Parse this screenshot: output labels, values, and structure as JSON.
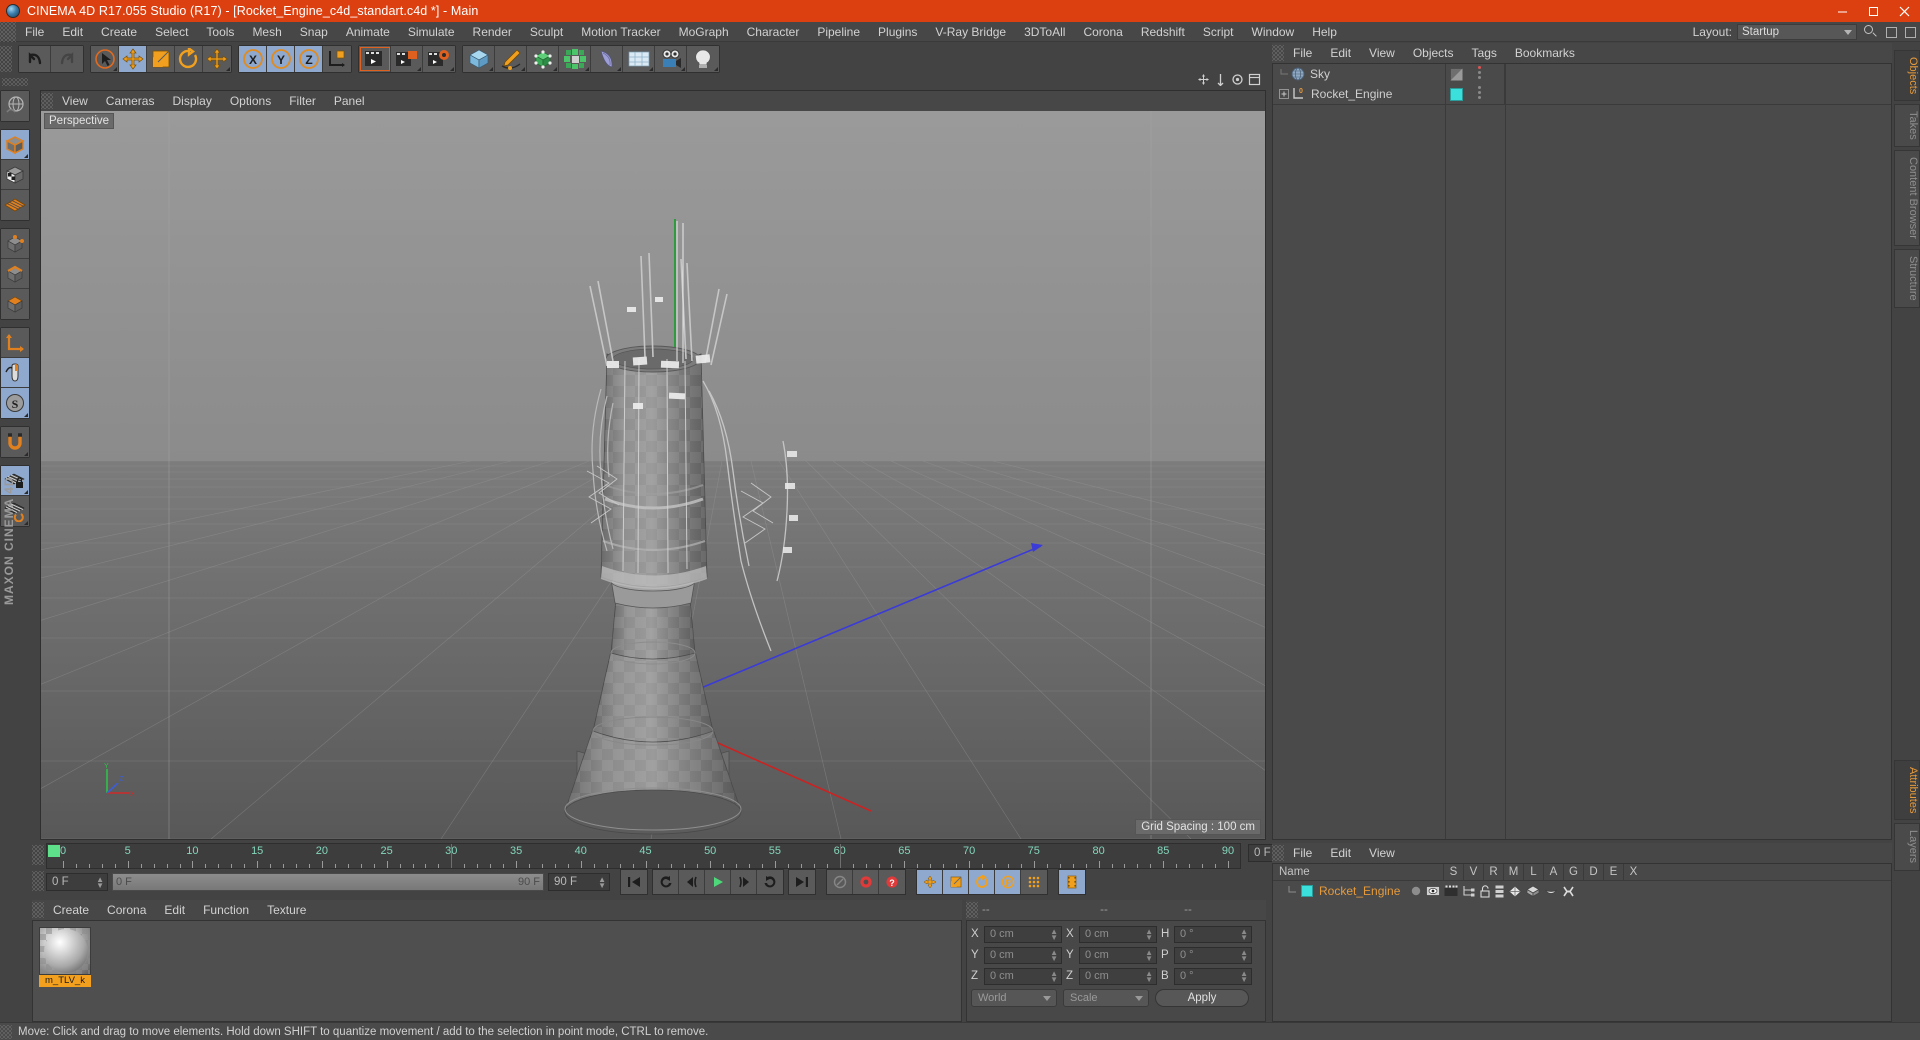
{
  "window": {
    "title": "CINEMA 4D R17.055 Studio (R17) - [Rocket_Engine_c4d_standart.c4d *] - Main",
    "minimize": "–",
    "maximize": "❐",
    "close": "✕"
  },
  "menubar": {
    "items": [
      "File",
      "Edit",
      "Create",
      "Select",
      "Tools",
      "Mesh",
      "Snap",
      "Animate",
      "Simulate",
      "Render",
      "Sculpt",
      "Motion Tracker",
      "MoGraph",
      "Character",
      "Pipeline",
      "Plugins",
      "V-Ray Bridge",
      "3DToAll",
      "Corona",
      "Redshift",
      "Script",
      "Window",
      "Help"
    ],
    "layout_label": "Layout:",
    "layout_value": "Startup",
    "search_icon": "search-icon"
  },
  "toolbar": {
    "groups": [
      {
        "name": "undo-redo",
        "buttons": [
          {
            "icon": "undo-icon",
            "label": "Undo",
            "active": false
          },
          {
            "icon": "redo-icon",
            "label": "Redo",
            "active": false,
            "disabled": true
          }
        ]
      },
      {
        "name": "transform-tools",
        "buttons": [
          {
            "icon": "select-live-icon",
            "label": "Live Selection",
            "active": false,
            "corner": true
          },
          {
            "icon": "move-icon",
            "label": "Move",
            "active": true
          },
          {
            "icon": "scale-icon",
            "label": "Scale",
            "active": false
          },
          {
            "icon": "rotate-icon",
            "label": "Rotate",
            "active": false
          },
          {
            "icon": "move-alt-icon",
            "label": "Move (Alt)",
            "active": false,
            "corner": true
          }
        ]
      },
      {
        "name": "axis-locks",
        "buttons": [
          {
            "icon": "axis-x-icon",
            "label": "X",
            "active": true
          },
          {
            "icon": "axis-y-icon",
            "label": "Y",
            "active": true
          },
          {
            "icon": "axis-z-icon",
            "label": "Z",
            "active": true
          },
          {
            "icon": "world-coord-icon",
            "label": "World / Object",
            "active": false
          }
        ]
      },
      {
        "name": "render-tools",
        "buttons": [
          {
            "icon": "render-view-icon",
            "label": "Render View",
            "active": false,
            "selected": true
          },
          {
            "icon": "render-picture-viewer-icon",
            "label": "Render to Picture Viewer",
            "active": false,
            "corner": true
          },
          {
            "icon": "render-settings-icon",
            "label": "Edit Render Settings",
            "active": false,
            "corner": true
          }
        ]
      },
      {
        "name": "create-objects",
        "buttons": [
          {
            "icon": "cube-primitive-icon",
            "label": "Cube",
            "active": false,
            "corner": true
          },
          {
            "icon": "spline-pen-icon",
            "label": "Pen / Spline",
            "active": false,
            "corner": true
          },
          {
            "icon": "nurbs-icon",
            "label": "Subdivision Surface",
            "active": false,
            "corner": true
          },
          {
            "icon": "array-icon",
            "label": "Array / Generators",
            "active": false,
            "corner": true
          },
          {
            "icon": "deformer-icon",
            "label": "Bend Deformer",
            "active": false,
            "corner": true
          },
          {
            "icon": "environment-icon",
            "label": "Floor / Environment",
            "active": false,
            "corner": true
          },
          {
            "icon": "camera-icon",
            "label": "Camera",
            "active": false,
            "corner": true
          },
          {
            "icon": "light-icon",
            "label": "Light",
            "active": false,
            "corner": true
          }
        ]
      }
    ]
  },
  "left_toolbar": {
    "groups": [
      [
        {
          "icon": "undo-view-icon",
          "label": "Undo View",
          "active": false
        }
      ],
      [
        {
          "icon": "model-mode-icon",
          "label": "Model Mode",
          "active": true,
          "corner": true
        },
        {
          "icon": "texture-mode-icon",
          "label": "Texture Mode",
          "active": false
        },
        {
          "icon": "workplane-icon",
          "label": "Workplane",
          "active": false
        }
      ],
      [
        {
          "icon": "points-mode-icon",
          "label": "Points",
          "active": false
        },
        {
          "icon": "edges-mode-icon",
          "label": "Edges",
          "active": false
        },
        {
          "icon": "polygons-mode-icon",
          "label": "Polygons",
          "active": false
        }
      ],
      [
        {
          "icon": "object-axis-icon",
          "label": "Enable Axis Modification",
          "active": false
        },
        {
          "icon": "viewport-solo-icon",
          "label": "Viewport Solo",
          "active": true
        },
        {
          "icon": "scale-snap-icon",
          "label": "Scale Snap",
          "active": true,
          "corner": true
        }
      ],
      [
        {
          "icon": "magnet-icon",
          "label": "Magnet",
          "active": false,
          "corner": true
        }
      ],
      [
        {
          "icon": "lock-workplane-icon",
          "label": "Lock Workplane",
          "active": true,
          "corner": true
        },
        {
          "icon": "planar-workplane-icon",
          "label": "Planar Workplane",
          "active": false,
          "corner": true
        }
      ]
    ],
    "brand": "MAXON CINEMA 4D"
  },
  "viewport": {
    "menu": [
      "View",
      "Cameras",
      "Display",
      "Options",
      "Filter",
      "Panel"
    ],
    "label": "Perspective",
    "grid_spacing": "Grid Spacing : 100 cm",
    "axis": {
      "x": "X",
      "y": "Y",
      "z": "Z"
    },
    "nav_icons": [
      "move-view-icon",
      "scale-view-icon",
      "rotate-view-icon",
      "maximize-view-icon"
    ]
  },
  "timeline": {
    "ticks": [
      0,
      5,
      10,
      15,
      20,
      25,
      30,
      35,
      40,
      45,
      50,
      55,
      60,
      65,
      70,
      75,
      80,
      85,
      90
    ],
    "current_frame_field": "0 F",
    "current_frame_slider": "0 F",
    "end_frame_slider": "90 F",
    "end_frame_field": "90 F",
    "playback_buttons": [
      {
        "icon": "go-to-start-icon",
        "label": "Go to Start"
      },
      {
        "icon": "prev-keyframe-icon",
        "label": "Go to Previous Key"
      },
      {
        "icon": "prev-frame-icon",
        "label": "Go to Previous Frame"
      },
      {
        "icon": "play-icon",
        "label": "Play Forwards"
      },
      {
        "icon": "next-frame-icon",
        "label": "Go to Next Frame"
      },
      {
        "icon": "next-keyframe-icon",
        "label": "Go to Next Key"
      },
      {
        "icon": "go-to-end-icon",
        "label": "Go to End"
      }
    ],
    "record_buttons": [
      {
        "icon": "autokey-icon",
        "label": "Autokeying",
        "active": false
      },
      {
        "icon": "record-icon",
        "label": "Record Active Objects",
        "active": true
      },
      {
        "icon": "key-selection-icon",
        "label": "Key Selection",
        "active": true
      }
    ],
    "key_toggles": [
      {
        "icon": "position-key-icon",
        "label": "Position",
        "active": true
      },
      {
        "icon": "scale-key-icon",
        "label": "Scale",
        "active": true
      },
      {
        "icon": "rotation-key-icon",
        "label": "Rotation",
        "active": true
      },
      {
        "icon": "param-key-icon",
        "label": "Parameter",
        "active": true
      },
      {
        "icon": "pla-key-icon",
        "label": "Point Level Animation",
        "active": false
      }
    ],
    "extra_button": {
      "icon": "timeline-icon",
      "label": "Timeline",
      "active": true
    }
  },
  "material_manager": {
    "menu": [
      "Create",
      "Corona",
      "Edit",
      "Function",
      "Texture"
    ],
    "materials": [
      {
        "name": "m_TLV_k",
        "thumbnail": "material-sphere-preview",
        "selected": true
      }
    ]
  },
  "coordinates": {
    "header": [
      "--",
      "--",
      "--"
    ],
    "rows": [
      {
        "pos_label": "X",
        "pos_value": "0 cm",
        "size_label": "X",
        "size_value": "0 cm",
        "rot_label": "H",
        "rot_value": "0 °"
      },
      {
        "pos_label": "Y",
        "pos_value": "0 cm",
        "size_label": "Y",
        "size_value": "0 cm",
        "rot_label": "P",
        "rot_value": "0 °"
      },
      {
        "pos_label": "Z",
        "pos_value": "0 cm",
        "size_label": "Z",
        "size_value": "0 cm",
        "rot_label": "B",
        "rot_value": "0 °"
      }
    ],
    "system": "World",
    "mode": "Scale",
    "apply": "Apply"
  },
  "object_manager": {
    "menu": [
      "File",
      "Edit",
      "View",
      "Objects",
      "Tags",
      "Bookmarks"
    ],
    "objects": [
      {
        "name": "Sky",
        "icon": "sky-object-icon",
        "tag_color": "none",
        "tag_icon": "sky-tag-icon",
        "dot_top": "#e05555",
        "dot_bottom": "#8a8a8a"
      },
      {
        "name": "Rocket_Engine",
        "icon": "null-object-icon",
        "tag_color": "#3be0dd",
        "tag_icon": "material-tag-icon",
        "dot_top": "#8a8a8a",
        "dot_bottom": "#8a8a8a",
        "expandable": true
      }
    ]
  },
  "attribute_manager": {
    "menu": [
      "File",
      "Edit",
      "View"
    ],
    "columns": [
      "Name",
      "S",
      "V",
      "R",
      "M",
      "L",
      "A",
      "G",
      "D",
      "E",
      "X"
    ],
    "rows": [
      {
        "name": "Rocket_Engine",
        "color": "#3be0dd",
        "tags": [
          "dot-icon",
          "display-tag-icon",
          "render-tag-icon",
          "hierarchy-icon",
          "unlock-icon",
          "layer-icon",
          "phong-tag-icon",
          "material-tag-icon",
          "uv-tag-icon",
          "constraint-icon"
        ]
      }
    ]
  },
  "right_tabs": {
    "top": [
      {
        "label": "Objects",
        "active": true
      },
      {
        "label": "Takes",
        "active": false
      },
      {
        "label": "Content Browser",
        "active": false
      },
      {
        "label": "Structure",
        "active": false
      }
    ],
    "bottom": [
      {
        "label": "Attributes",
        "active": true
      },
      {
        "label": "Layers",
        "active": false
      }
    ]
  },
  "statusbar": {
    "text": "Move: Click and drag to move elements. Hold down SHIFT to quantize movement / add to the selection in point mode, CTRL to remove."
  },
  "colors": {
    "brand_orange": "#dd4010",
    "accent_orange": "#e59a3c",
    "active_blue": "#8fa8cd",
    "panel_bg": "#434343",
    "teal_tag": "#3be0dd"
  }
}
